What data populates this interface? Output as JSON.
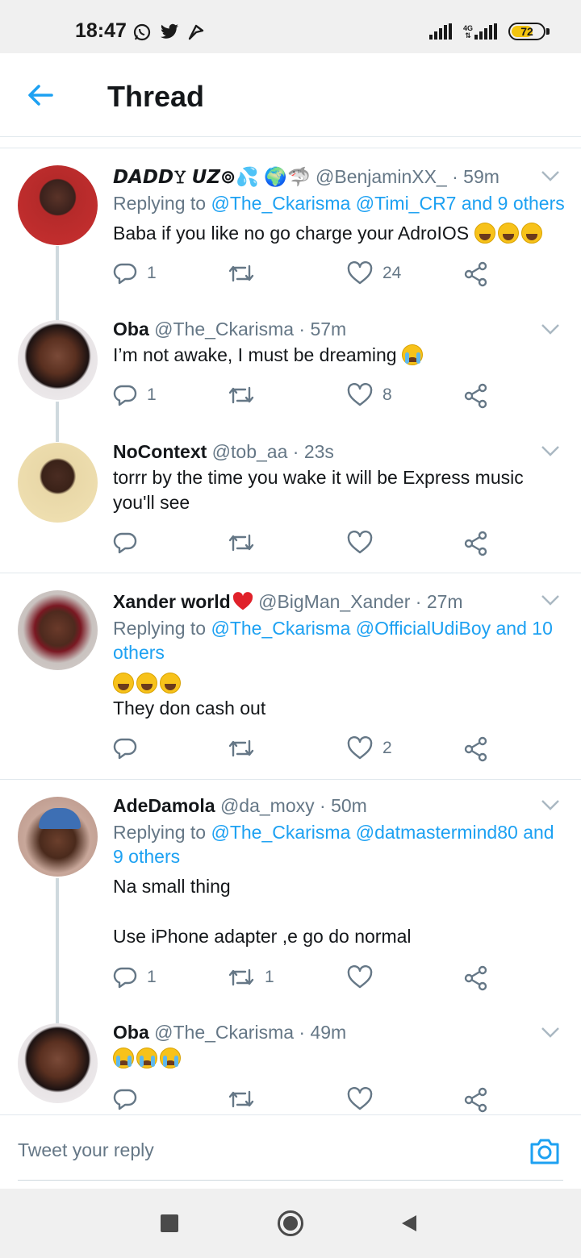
{
  "status_bar": {
    "time": "18:47",
    "network": "4G",
    "battery": 72,
    "battery_color": "#f2c40f",
    "left_icons": [
      "whatsapp-icon",
      "twitter-icon",
      "app-notification-icon"
    ]
  },
  "header": {
    "title": "Thread",
    "accent_color": "#1da1f2"
  },
  "tweets": [
    {
      "display_name": "𝘿𝘼𝘿𝘿𝚈 𝙐𝙕⊚💦 🌍🦈",
      "handle": "@BenjaminXX_",
      "time": "· 59m",
      "replying_label": "Replying to ",
      "replying_mentions": "@The_Ckarisma @Timi_CR7 and 9 others",
      "text": "Baba if you like no go charge your AdroIOS",
      "emoji_count": 3,
      "emoji_type": "laugh",
      "replies": "1",
      "retweets": "",
      "likes": "24"
    },
    {
      "display_name": "Oba",
      "handle": "@The_Ckarisma",
      "time": "· 57m",
      "text": "I’m not awake, I must be dreaming",
      "emoji_count": 1,
      "emoji_type": "cry",
      "replies": "1",
      "retweets": "",
      "likes": "8"
    },
    {
      "display_name": "NoContext",
      "handle": "@tob_aa",
      "time": "· 23s",
      "text": "torrr by the time you wake it will be Express music you'll see",
      "replies": "",
      "retweets": "",
      "likes": ""
    },
    {
      "display_name": "Xander world",
      "handle": "@BigMan_Xander",
      "time": "· 27m",
      "replying_label": "Replying to ",
      "replying_mentions": "@The_Ckarisma @OfficialUdiBoy and 10 others",
      "text": "They don cash out",
      "emoji_count": 3,
      "emoji_type": "laugh",
      "replies": "",
      "retweets": "",
      "likes": "2"
    },
    {
      "display_name": "AdeDamola",
      "handle": "@da_moxy",
      "time": "· 50m",
      "replying_label": "Replying to ",
      "replying_mentions": "@The_Ckarisma @datmastermind80 and 9 others",
      "text": "Na small thing\n\nUse iPhone adapter  ,e go do normal",
      "replies": "1",
      "retweets": "1",
      "likes": ""
    },
    {
      "display_name": "Oba",
      "handle": "@The_Ckarisma",
      "time": "· 49m",
      "text": "",
      "emoji_count": 3,
      "emoji_type": "cry",
      "replies": "",
      "retweets": "",
      "likes": ""
    }
  ],
  "reply_bar": {
    "placeholder": "Tweet your reply"
  },
  "nav_bar": {
    "buttons": [
      "recents-button",
      "home-button",
      "back-button"
    ]
  }
}
